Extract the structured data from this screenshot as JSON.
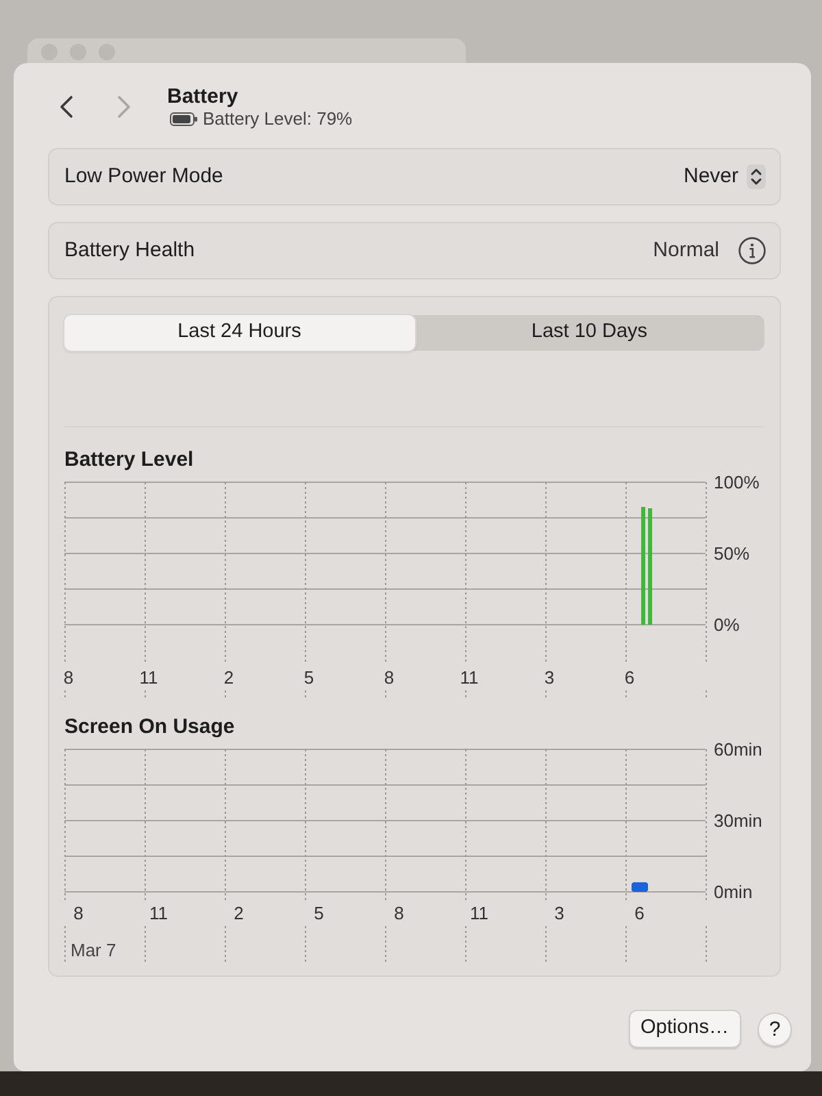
{
  "navigation": [
    {
      "kind": "back",
      "disabled": false
    },
    {
      "kind": "forward",
      "disabled": true
    }
  ],
  "header": {
    "title": "Battery",
    "subtitle": "Battery Level: 79%"
  },
  "settings": [
    {
      "kind": "popup",
      "label": "Low Power Mode",
      "value": "Never"
    },
    {
      "kind": "info",
      "label": "Battery Health",
      "value": "Normal"
    }
  ],
  "tabs": [
    {
      "label": "Last 24 Hours",
      "selected": true
    },
    {
      "label": "Last 10 Days",
      "selected": false
    }
  ],
  "charts": [
    {
      "chart_data": {
        "type": "bar",
        "title": "Battery Level",
        "categories": [
          "8",
          null,
          null,
          null,
          null,
          null,
          null,
          null,
          null,
          null,
          null,
          null,
          "11",
          null,
          null,
          null,
          null,
          null,
          null,
          null,
          null,
          null,
          null,
          null,
          "2",
          null,
          null,
          null,
          null,
          null,
          null,
          null,
          null,
          null,
          null,
          null,
          "5",
          null,
          null,
          null,
          null,
          null,
          null,
          null,
          null,
          null,
          null,
          null,
          "8",
          null,
          null,
          null,
          null,
          null,
          null,
          null,
          null,
          null,
          null,
          null,
          "11",
          null,
          null,
          null,
          null,
          null,
          null,
          null,
          null,
          null,
          null,
          null,
          "3",
          null,
          null,
          null,
          null,
          null,
          null,
          null,
          null,
          null,
          null,
          null,
          "6",
          null,
          null,
          null,
          null,
          null,
          null,
          null,
          null,
          null,
          null,
          null
        ],
        "series": [
          {
            "color": "#3cb83a",
            "values": [
              null,
              null,
              null,
              null,
              null,
              null,
              null,
              null,
              null,
              null,
              null,
              null,
              null,
              null,
              null,
              null,
              null,
              null,
              null,
              null,
              null,
              null,
              null,
              null,
              null,
              null,
              null,
              null,
              null,
              null,
              null,
              null,
              null,
              null,
              null,
              null,
              null,
              null,
              null,
              null,
              null,
              null,
              null,
              null,
              null,
              null,
              null,
              null,
              null,
              null,
              null,
              null,
              null,
              null,
              null,
              null,
              null,
              null,
              null,
              null,
              null,
              null,
              null,
              null,
              null,
              null,
              null,
              null,
              null,
              null,
              null,
              null,
              null,
              null,
              null,
              null,
              null,
              null,
              null,
              null,
              null,
              null,
              null,
              null,
              null,
              null,
              83,
              82,
              null,
              null,
              null,
              null,
              null,
              null,
              null,
              null
            ]
          }
        ],
        "ylim": [
          0,
          100
        ],
        "yticks": [
          {
            "value": 0,
            "label": "0%"
          },
          {
            "value": 50,
            "label": "50%"
          },
          {
            "value": 100,
            "label": "100%"
          }
        ]
      }
    },
    {
      "chart_data": {
        "type": "bar",
        "title": "Screen On Usage",
        "categories": [
          "8",
          null,
          null,
          "11",
          null,
          null,
          "2",
          null,
          null,
          "5",
          null,
          null,
          "8",
          null,
          null,
          "11",
          null,
          null,
          "3",
          null,
          null,
          "6",
          null,
          null
        ],
        "series": [
          {
            "color": "#1a63d8",
            "values": [
              null,
              null,
              null,
              null,
              null,
              null,
              null,
              null,
              null,
              null,
              null,
              null,
              null,
              null,
              null,
              null,
              null,
              null,
              null,
              null,
              null,
              4,
              null,
              null
            ]
          }
        ],
        "ylim": [
          0,
          60
        ],
        "yticks": [
          {
            "value": 0,
            "label": "0min"
          },
          {
            "value": 30,
            "label": "30min"
          },
          {
            "value": 60,
            "label": "60min"
          }
        ]
      },
      "date_label": "Mar 7"
    }
  ],
  "footer": {
    "options_button": "Options…",
    "help_button": "?"
  }
}
